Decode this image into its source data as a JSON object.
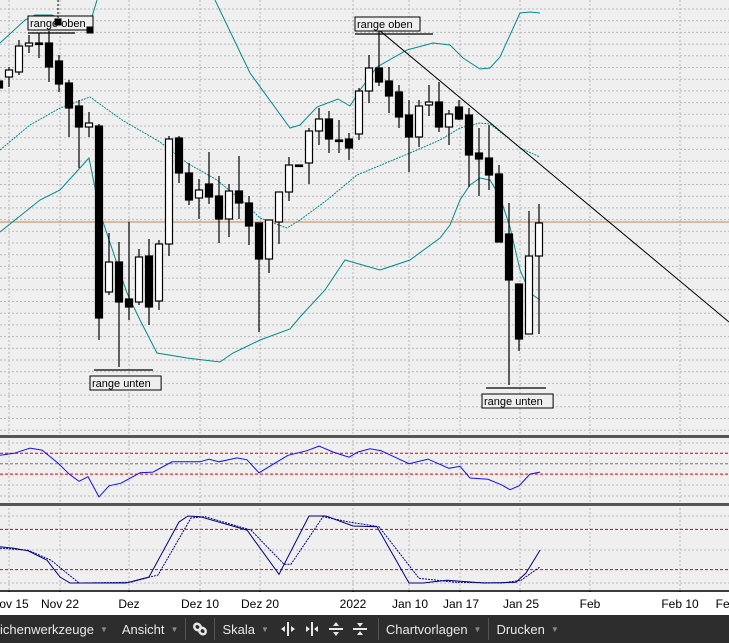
{
  "colors": {
    "background": "#efefef",
    "grid": "#b8b8b8",
    "candle": "#000000",
    "bollinger": "#008b8b",
    "trendline": "#000000",
    "hline": "#c08050",
    "rsi": "#1010ff",
    "level_red": "#e00000",
    "stoch": "#000080",
    "separator": "#555555"
  },
  "chart_data": [
    {
      "type": "candlestick",
      "title": "",
      "x_unit": "trading-day index",
      "candles": [
        [
          419,
          422,
          408,
          412
        ],
        [
          423,
          433,
          413,
          430
        ],
        [
          428,
          460,
          425,
          454
        ],
        [
          454,
          465,
          447,
          457
        ],
        [
          457,
          467,
          442,
          456
        ],
        [
          457,
          469,
          418,
          433
        ],
        [
          439,
          445,
          408,
          416
        ],
        [
          417,
          420,
          363,
          392
        ],
        [
          394,
          400,
          332,
          373
        ],
        [
          373,
          388,
          363,
          377
        ],
        [
          374,
          376,
          160,
          182
        ],
        [
          208,
          267,
          205,
          238
        ],
        [
          238,
          258,
          133,
          198
        ],
        [
          201,
          278,
          180,
          193
        ],
        [
          198,
          251,
          195,
          243
        ],
        [
          244,
          261,
          175,
          193
        ],
        [
          199,
          260,
          190,
          256
        ],
        [
          256,
          364,
          244,
          361
        ],
        [
          362,
          364,
          317,
          327
        ],
        [
          327,
          337,
          295,
          300
        ],
        [
          302,
          321,
          281,
          310
        ],
        [
          316,
          348,
          296,
          303
        ],
        [
          304,
          324,
          257,
          281
        ],
        [
          281,
          316,
          263,
          309
        ],
        [
          309,
          344,
          281,
          297
        ],
        [
          297,
          304,
          255,
          274
        ],
        [
          277,
          277,
          168,
          241
        ],
        [
          241,
          280,
          227,
          280
        ],
        [
          278,
          308,
          256,
          308
        ],
        [
          308,
          343,
          299,
          335
        ],
        [
          335,
          335,
          334,
          334
        ],
        [
          337,
          372,
          316,
          369
        ],
        [
          369,
          392,
          355,
          381
        ],
        [
          381,
          389,
          347,
          361
        ],
        [
          360,
          380,
          347,
          360
        ],
        [
          361,
          367,
          340,
          352
        ],
        [
          366,
          412,
          360,
          409
        ],
        [
          409,
          445,
          397,
          432
        ],
        [
          432,
          470,
          414,
          418
        ],
        [
          419,
          433,
          387,
          404
        ],
        [
          408,
          415,
          372,
          383
        ],
        [
          385,
          400,
          328,
          363
        ],
        [
          363,
          400,
          353,
          394
        ],
        [
          395,
          415,
          384,
          398
        ],
        [
          398,
          418,
          368,
          373
        ],
        [
          373,
          390,
          355,
          386
        ],
        [
          393,
          400,
          380,
          381
        ],
        [
          385,
          392,
          313,
          345
        ],
        [
          347,
          372,
          304,
          341
        ],
        [
          342,
          375,
          310,
          325
        ],
        [
          326,
          335,
          258,
          258
        ],
        [
          266,
          297,
          115,
          220
        ],
        [
          216,
          216,
          149,
          161
        ],
        [
          166,
          289,
          166,
          244
        ],
        [
          244,
          296,
          166,
          277
        ]
      ],
      "candle_fields": [
        "open",
        "high",
        "low",
        "close"
      ],
      "bollinger": {
        "upper": [
          [
            [
              0.1,
              457
            ],
            [
              2.6,
              480
            ],
            [
              3.6,
              485
            ],
            [
              5.3,
              485
            ],
            [
              7.1,
              478
            ],
            [
              8.9,
              470
            ],
            [
              9.8,
              500
            ]
          ],
          [
            [
              21.6,
              500
            ],
            [
              25.1,
              427
            ],
            [
              29.1,
              372
            ],
            [
              30.1,
              375
            ],
            [
              31.8,
              393
            ],
            [
              33.9,
              401
            ],
            [
              35.1,
              394
            ],
            [
              36.1,
              410
            ],
            [
              37.8,
              433
            ],
            [
              40.8,
              450
            ],
            [
              43.4,
              457
            ],
            [
              45.1,
              455
            ],
            [
              46.4,
              442
            ],
            [
              48.1,
              431
            ],
            [
              49.1,
              432
            ],
            [
              50.1,
              443
            ],
            [
              52.1,
              487
            ],
            [
              53.1,
              488
            ],
            [
              54.1,
              487
            ]
          ]
        ],
        "middle": [
          [
            0.1,
            350
          ],
          [
            3.1,
            375
          ],
          [
            6.1,
            392
          ],
          [
            9.1,
            403
          ],
          [
            12.3,
            380
          ],
          [
            16.1,
            358
          ],
          [
            18.8,
            337
          ],
          [
            21.8,
            320
          ],
          [
            24.8,
            295
          ],
          [
            26.1,
            282
          ],
          [
            28.8,
            272
          ],
          [
            30.1,
            280
          ],
          [
            32.8,
            300
          ],
          [
            35.8,
            325
          ],
          [
            41.1,
            347
          ],
          [
            44.1,
            360
          ],
          [
            46.1,
            372
          ],
          [
            48.1,
            377
          ],
          [
            49.1,
            376
          ],
          [
            50.8,
            363
          ],
          [
            52.1,
            352
          ],
          [
            54.1,
            343
          ]
        ],
        "lower": [
          [
            0.1,
            268
          ],
          [
            4.1,
            300
          ],
          [
            6.1,
            310
          ],
          [
            9,
            342
          ],
          [
            10.1,
            287
          ],
          [
            12.8,
            207
          ],
          [
            14.1,
            180
          ],
          [
            15.8,
            147
          ],
          [
            18.8,
            142
          ],
          [
            22.1,
            138
          ],
          [
            23.4,
            147
          ],
          [
            26.1,
            160
          ],
          [
            29.1,
            171
          ],
          [
            30.1,
            183
          ],
          [
            32.6,
            210
          ],
          [
            34.6,
            240
          ],
          [
            38.1,
            230
          ],
          [
            41.1,
            240
          ],
          [
            44.1,
            262
          ],
          [
            45.1,
            275
          ],
          [
            46.1,
            300
          ],
          [
            47.1,
            315
          ],
          [
            48.1,
            322
          ],
          [
            49.1,
            320
          ],
          [
            50.1,
            303
          ],
          [
            51.1,
            273
          ],
          [
            52.1,
            230
          ],
          [
            53.1,
            207
          ],
          [
            54.1,
            200
          ]
        ]
      },
      "trendline": [
        [
          38,
          470
        ],
        [
          73,
          178
        ]
      ],
      "horizontal_line": 278,
      "annotations": [
        {
          "text": "range oben",
          "level": 467,
          "from": 2.9,
          "to": 7.6,
          "label_pos": "above"
        },
        {
          "text": "range oben",
          "level": 466,
          "from": 35.6,
          "to": 43.4,
          "label_pos": "above"
        },
        {
          "text": "range unten",
          "level": 130,
          "from": 9.5,
          "to": 15.4,
          "label_pos": "below"
        },
        {
          "text": "range unten",
          "level": 112,
          "from": 48.7,
          "to": 54.7,
          "label_pos": "below"
        }
      ]
    },
    {
      "type": "line",
      "name": "oscillator",
      "levels_red": [
        78,
        46
      ],
      "level_mid": 62,
      "points": [
        [
          0.1,
          75
        ],
        [
          1.5,
          78
        ],
        [
          3.1,
          86
        ],
        [
          4.3,
          83
        ],
        [
          5.9,
          63
        ],
        [
          7.1,
          45
        ],
        [
          8,
          35
        ],
        [
          8.9,
          42
        ],
        [
          10,
          11
        ],
        [
          11,
          28
        ],
        [
          12.2,
          32
        ],
        [
          14.1,
          48
        ],
        [
          15.4,
          49
        ],
        [
          17.3,
          65
        ],
        [
          18.7,
          65
        ],
        [
          20.1,
          65
        ],
        [
          21,
          69
        ],
        [
          22,
          65
        ],
        [
          23.8,
          71
        ],
        [
          24.8,
          68
        ],
        [
          26,
          48
        ],
        [
          27.5,
          62
        ],
        [
          28.9,
          75
        ],
        [
          30.8,
          82
        ],
        [
          32,
          89
        ],
        [
          33.4,
          80
        ],
        [
          35,
          72
        ],
        [
          35.9,
          80
        ],
        [
          37.1,
          85
        ],
        [
          38.2,
          82
        ],
        [
          39.6,
          72
        ],
        [
          41,
          62
        ],
        [
          42.9,
          69
        ],
        [
          45,
          55
        ],
        [
          46.1,
          58
        ],
        [
          47.1,
          40
        ],
        [
          48.9,
          38
        ],
        [
          50.3,
          29
        ],
        [
          51.1,
          22
        ],
        [
          52,
          28
        ],
        [
          53.1,
          46
        ],
        [
          54.1,
          49
        ]
      ]
    },
    {
      "type": "line",
      "name": "stochastic",
      "ylim": [
        0,
        100
      ],
      "levels_red": [
        80,
        20
      ],
      "series": [
        {
          "name": "%K",
          "style": "solid",
          "points": [
            [
              0.1,
              54
            ],
            [
              1.5,
              52
            ],
            [
              2.9,
              48
            ],
            [
              4.8,
              34
            ],
            [
              6.1,
              9
            ],
            [
              7.1,
              0
            ],
            [
              12.7,
              0
            ],
            [
              15,
              9
            ],
            [
              18,
              91
            ],
            [
              18.9,
              100
            ],
            [
              20.1,
              99
            ],
            [
              24.8,
              79
            ],
            [
              28,
              13
            ],
            [
              31,
              100
            ],
            [
              32.7,
              100
            ],
            [
              35.4,
              85
            ],
            [
              37.8,
              84
            ],
            [
              41,
              0
            ],
            [
              42.4,
              0
            ],
            [
              44.8,
              4
            ],
            [
              48.5,
              0
            ],
            [
              51.7,
              1
            ],
            [
              52.7,
              15
            ],
            [
              54.1,
              49
            ]
          ]
        },
        {
          "name": "%D",
          "style": "dashed",
          "points": [
            [
              0.1,
              52
            ],
            [
              2.9,
              49
            ],
            [
              5.2,
              34
            ],
            [
              8,
              0
            ],
            [
              13.1,
              1
            ],
            [
              15.9,
              12
            ],
            [
              19.2,
              97
            ],
            [
              20.6,
              99
            ],
            [
              25.2,
              79
            ],
            [
              28.5,
              28
            ],
            [
              29.2,
              28
            ],
            [
              32.4,
              99
            ],
            [
              35,
              91
            ],
            [
              38,
              84
            ],
            [
              42,
              7
            ],
            [
              45.7,
              1
            ],
            [
              50.3,
              0
            ],
            [
              52.2,
              4
            ],
            [
              54.1,
              24
            ]
          ]
        }
      ]
    }
  ],
  "x_axis": {
    "ticks": [
      "ov 15",
      "Nov 22",
      "Dez",
      "Dez 10",
      "Dez 20",
      "2022",
      "Jan 10",
      "Jan 17",
      "Jan 25",
      "Feb",
      "Feb 10",
      "Feb"
    ]
  },
  "toolbar": {
    "drawing_tools": "ichenwerkzeuge",
    "view": "Ansicht",
    "scale": "Skala",
    "templates": "Chartvorlagen",
    "print": "Drucken"
  }
}
